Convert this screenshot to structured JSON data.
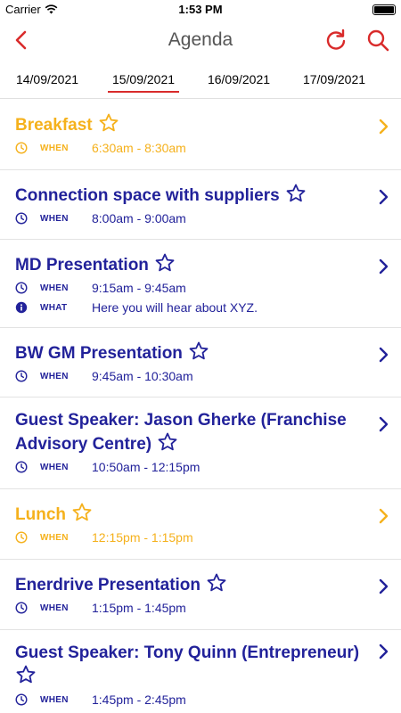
{
  "status": {
    "carrier": "Carrier",
    "time": "1:53 PM"
  },
  "nav": {
    "title": "Agenda"
  },
  "tabs": [
    "14/09/2021",
    "15/09/2021",
    "16/09/2021",
    "17/09/2021"
  ],
  "items": [
    {
      "title": "Breakfast",
      "when_label": "WHEN",
      "when": "6:30am - 8:30am"
    },
    {
      "title": "Connection space with suppliers",
      "when_label": "WHEN",
      "when": "8:00am - 9:00am"
    },
    {
      "title": "MD Presentation",
      "when_label": "WHEN",
      "when": "9:15am - 9:45am",
      "what_label": "WHAT",
      "what": "Here you will hear about XYZ."
    },
    {
      "title": "BW GM Presentation",
      "when_label": "WHEN",
      "when": "9:45am - 10:30am"
    },
    {
      "title_line1": "Guest Speaker: Jason Gherke (Franchise",
      "title_line2": "Advisory Centre)",
      "when_label": "WHEN",
      "when": "10:50am - 12:15pm"
    },
    {
      "title": "Lunch",
      "when_label": "WHEN",
      "when": "12:15pm - 1:15pm"
    },
    {
      "title": "Enerdrive Presentation",
      "when_label": "WHEN",
      "when": "1:15pm - 1:45pm"
    },
    {
      "title": "Guest Speaker: Tony Quinn (Entrepreneur)",
      "when_label": "WHEN",
      "when": "1:45pm - 2:45pm"
    }
  ],
  "colors": {
    "accent": "#d92b2b",
    "session": "#22229a",
    "break": "#f5b11c"
  },
  "icons": [
    "back-icon",
    "refresh-icon",
    "search-icon",
    "star-icon",
    "clock-icon",
    "info-icon",
    "chevron-right-icon"
  ]
}
